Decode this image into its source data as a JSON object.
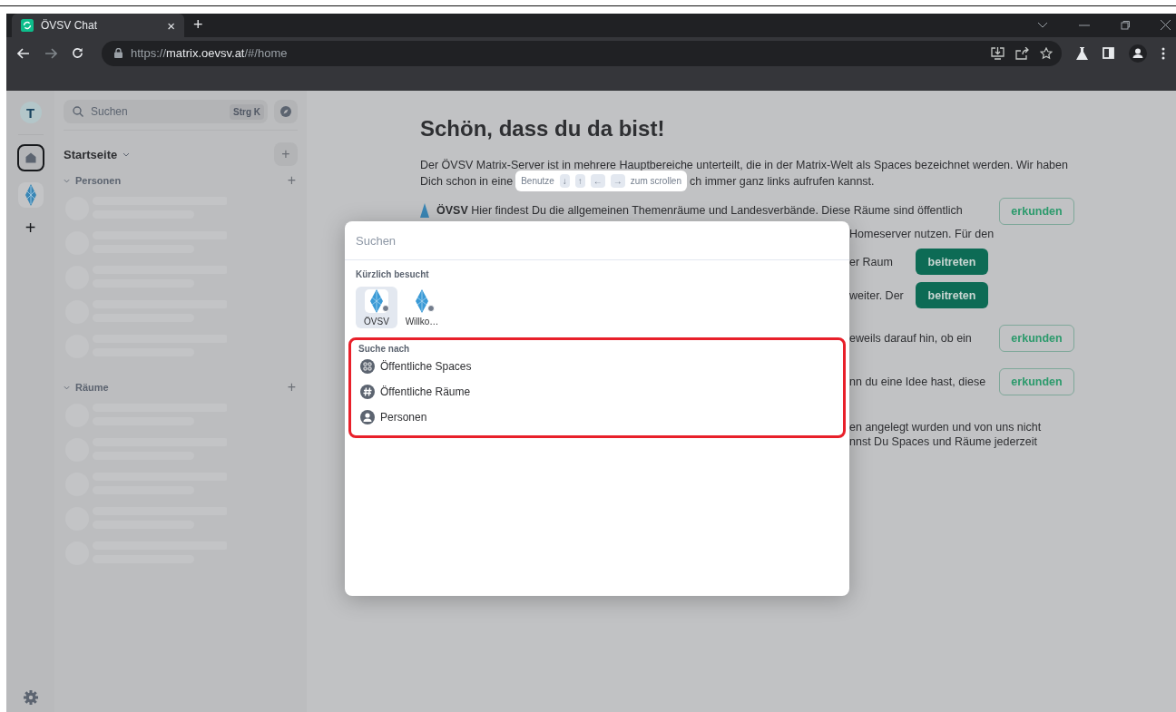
{
  "browser": {
    "tab_title": "ÖVSV Chat",
    "tab_close": "×",
    "new_tab": "+",
    "url_scheme": "https://",
    "url_host": "matrix.oevsv.at",
    "url_path": "/#/home"
  },
  "space_bar": {
    "avatar": "T",
    "spaces": [
      {
        "kind": "home",
        "selected": true
      },
      {
        "kind": "space",
        "selected": false
      }
    ],
    "add": "+"
  },
  "room_list": {
    "search_placeholder": "Suchen",
    "shortcut": "Strg K",
    "heading": "Startseite",
    "add": "+",
    "sections": [
      {
        "title": "Personen",
        "add": "+",
        "expanded": true
      },
      {
        "title": "Räume",
        "add": "+",
        "expanded": true
      }
    ]
  },
  "main": {
    "title": "Schön, dass du da bist!",
    "intro_line1": "Der ÖVSV Matrix-Server ist in mehrere Hauptbereiche unterteilt, die in der Matrix-Welt als Spaces bezeichnet werden. Wir haben",
    "intro_line2_start": "Dich schon in eine",
    "intro_line2_end": "ch immer ganz links aufrufen kannst.",
    "first_row": {
      "name": "ÖVSV",
      "text": "Hier findest Du die allgemeinen Themenräume und Landesverbände. Diese Räume sind öffentlich",
      "fragment": "Homeserver nutzen. Für den",
      "button": "erkunden"
    },
    "rows": [
      {
        "lines": [
          "er Raum"
        ],
        "button": {
          "kind": "primary",
          "label": "beitreten"
        }
      },
      {
        "lines": [
          "weiter. Der"
        ],
        "button": {
          "kind": "primary",
          "label": "beitreten"
        }
      },
      {
        "lines": [
          "eweils darauf hin, ob ein"
        ],
        "button": {
          "kind": "outline",
          "label": "erkunden"
        }
      },
      {
        "lines": [
          "nn du eine Idee hast, diese"
        ],
        "button": {
          "kind": "outline",
          "label": "erkunden"
        }
      },
      {
        "lines": [
          "en angelegt wurden und von uns nicht",
          "nnst Du Spaces und Räume jederzeit"
        ]
      }
    ]
  },
  "scroll_hint": {
    "before": "Benutze",
    "keys": [
      "↓",
      "↑",
      "←",
      "→"
    ],
    "after": "zum scrollen"
  },
  "search_dialog": {
    "placeholder": "Suchen",
    "recent_heading": "Kürzlich besucht",
    "recent": [
      {
        "label": "ÖVSV",
        "selected": true
      },
      {
        "label": "Willko…",
        "selected": false
      }
    ],
    "search_for_heading": "Suche nach",
    "highlighted": true,
    "options": [
      {
        "kind": "spaces",
        "label": "Öffentliche Spaces"
      },
      {
        "kind": "rooms",
        "label": "Öffentliche Räume"
      },
      {
        "kind": "people",
        "label": "Personen"
      }
    ]
  }
}
